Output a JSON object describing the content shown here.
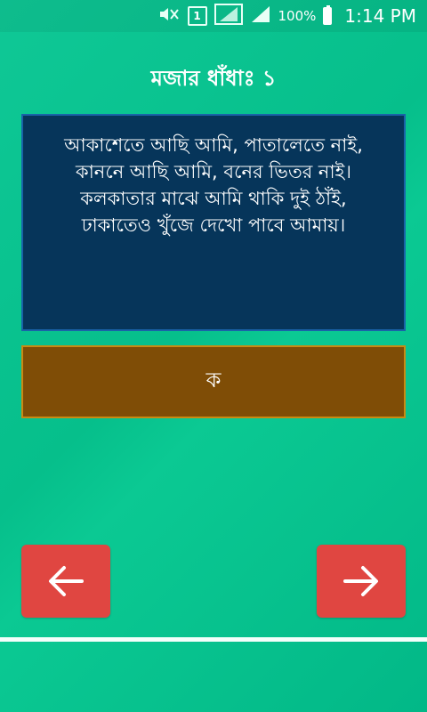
{
  "status_bar": {
    "sim_label": "1",
    "battery_text": "100%",
    "time": "1:14 PM"
  },
  "header": {
    "title": "মজার ধাঁধাঃ ১"
  },
  "riddle": {
    "lines": [
      "আকাশেতে আছি আমি, পাতালেতে নাই,",
      "কাননে আছি আমি, বনের ভিতর নাই।",
      "কলকাতার মাঝে আমি থাকি দুই ঠাঁই,",
      "ঢাকাতেও খুঁজে দেখো পাবে আমায়।"
    ]
  },
  "answer": {
    "text": "ক"
  },
  "navigation": {
    "prev_icon": "arrow-left-icon",
    "next_icon": "arrow-right-icon"
  },
  "colors": {
    "background": "#06bf8b",
    "riddle_bg": "#06355a",
    "answer_bg": "#7f4d06",
    "button_bg": "#e04641"
  }
}
